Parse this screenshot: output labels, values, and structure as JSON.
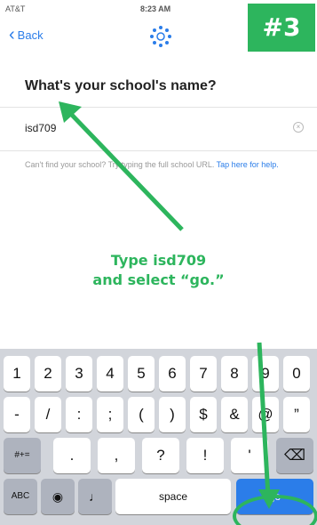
{
  "status_bar": {
    "carrier": "AT&T",
    "time": "8:23 AM"
  },
  "nav": {
    "back_label": "Back",
    "logo_icon": "canvas-logo-icon"
  },
  "badge": "#3",
  "question": "What's your school's name?",
  "search": {
    "value": "isd709",
    "clear_icon": "clear-icon"
  },
  "hint": {
    "text": "Can't find your school? Try typing the full school URL.",
    "link": "Tap here for help."
  },
  "instruction": {
    "line1": "Type isd709",
    "line2": "and select “go.”"
  },
  "keyboard": {
    "row1": [
      "1",
      "2",
      "3",
      "4",
      "5",
      "6",
      "7",
      "8",
      "9",
      "0"
    ],
    "row2": [
      "-",
      "/",
      ":",
      ";",
      "(",
      ")",
      "$",
      "&",
      "@",
      "”"
    ],
    "row3": [
      "#+=",
      ".",
      ",",
      "?",
      "!",
      "'"
    ],
    "row4": {
      "abc": "ABC",
      "globe": "globe-icon",
      "mic": "mic-icon",
      "space": "space",
      "go": "go"
    },
    "delete_icon": "delete-icon"
  },
  "colors": {
    "accent": "#2db55d",
    "link": "#2b7de9"
  }
}
